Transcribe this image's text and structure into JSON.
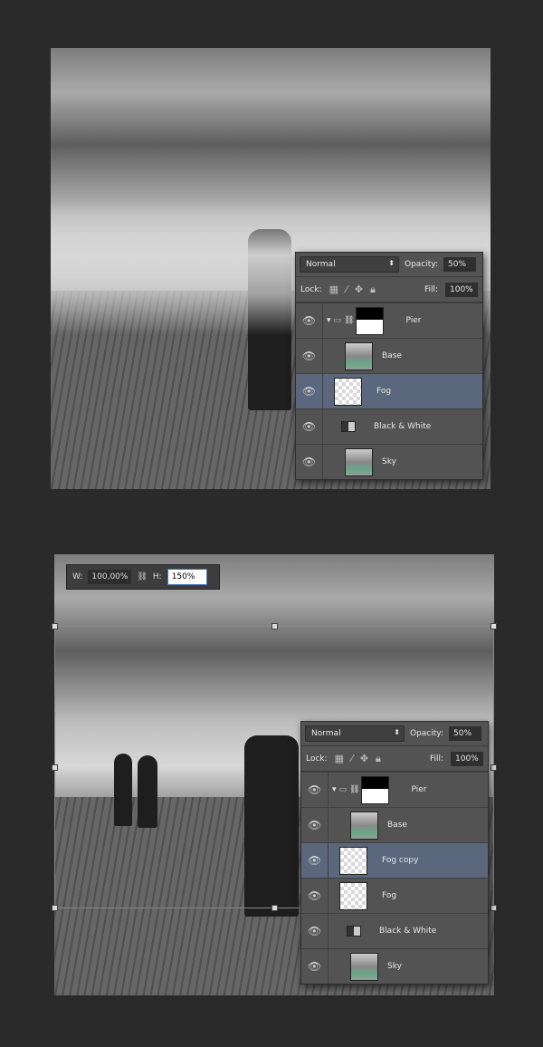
{
  "screens": [
    {
      "blend_mode": "Normal",
      "opacity_label": "Opacity:",
      "opacity": "50%",
      "lock_label": "Lock:",
      "fill_label": "Fill:",
      "fill": "100%",
      "layers": [
        {
          "name": "Pier",
          "kind": "group"
        },
        {
          "name": "Base",
          "kind": "photo"
        },
        {
          "name": "Fog",
          "kind": "empty",
          "selected": true
        },
        {
          "name": "Black & White",
          "kind": "adjustment"
        },
        {
          "name": "Sky",
          "kind": "photo"
        }
      ]
    },
    {
      "blend_mode": "Normal",
      "opacity_label": "Opacity:",
      "opacity": "50%",
      "lock_label": "Lock:",
      "fill_label": "Fill:",
      "fill": "100%",
      "layers": [
        {
          "name": "Pier",
          "kind": "group"
        },
        {
          "name": "Base",
          "kind": "photo"
        },
        {
          "name": "Fog copy",
          "kind": "empty",
          "selected": true
        },
        {
          "name": "Fog",
          "kind": "empty"
        },
        {
          "name": "Black & White",
          "kind": "adjustment"
        },
        {
          "name": "Sky",
          "kind": "photo"
        }
      ]
    }
  ],
  "transform": {
    "w_label": "W:",
    "w_value": "100,00%",
    "h_label": "H:",
    "h_value": "150%"
  }
}
